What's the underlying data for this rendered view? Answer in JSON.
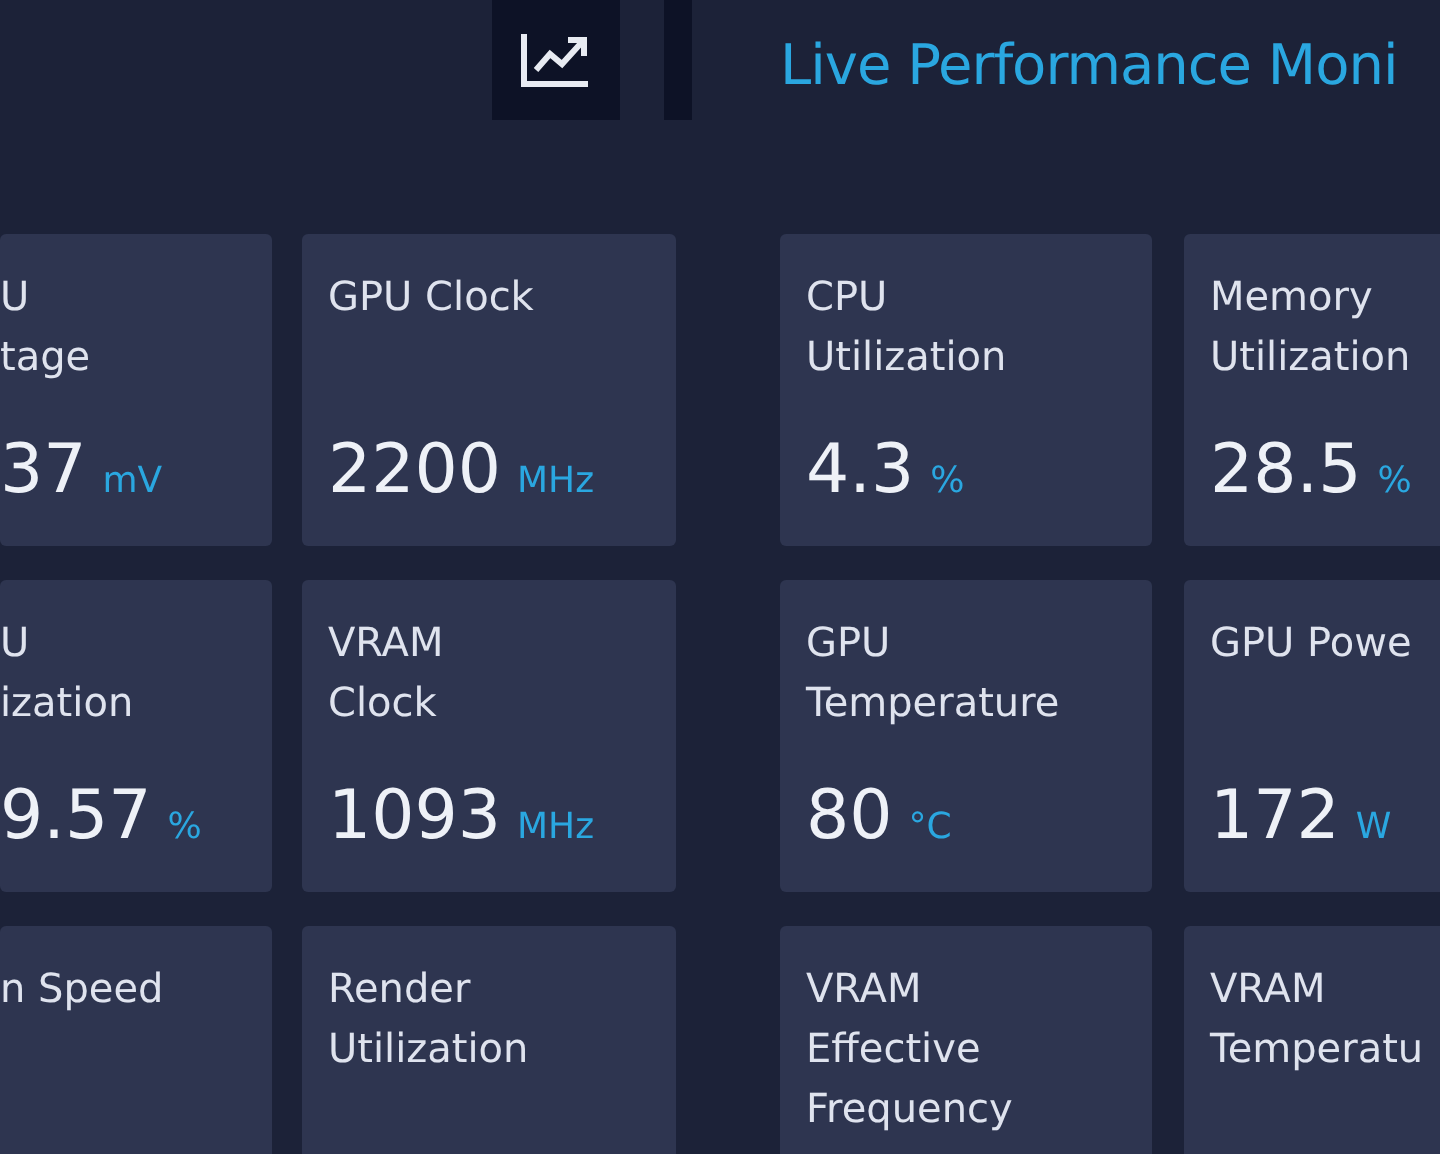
{
  "header": {
    "title": "Live Performance Moni"
  },
  "left_panel": {
    "cards": [
      {
        "label": "U\ntage",
        "value": "37",
        "unit": "mV"
      },
      {
        "label": "GPU Clock",
        "value": "2200",
        "unit": "MHz"
      },
      {
        "label": "U\nization",
        "value": "9.57",
        "unit": "%"
      },
      {
        "label": "VRAM\nClock",
        "value": "1093",
        "unit": "MHz"
      },
      {
        "label": "n Speed"
      },
      {
        "label": "Render\nUtilization"
      }
    ]
  },
  "right_panel": {
    "cards": [
      {
        "label": "CPU\nUtilization",
        "value": "4.3",
        "unit": "%"
      },
      {
        "label": "Memory\nUtilization",
        "value": "28.5",
        "unit": "%"
      },
      {
        "label": "GPU\nTemperature",
        "value": "80",
        "unit": "°C"
      },
      {
        "label": "GPU Powe",
        "value": "172",
        "unit": "W"
      },
      {
        "label": "VRAM\nEffective\nFrequency"
      },
      {
        "label": "VRAM\nTemperatu"
      }
    ]
  }
}
